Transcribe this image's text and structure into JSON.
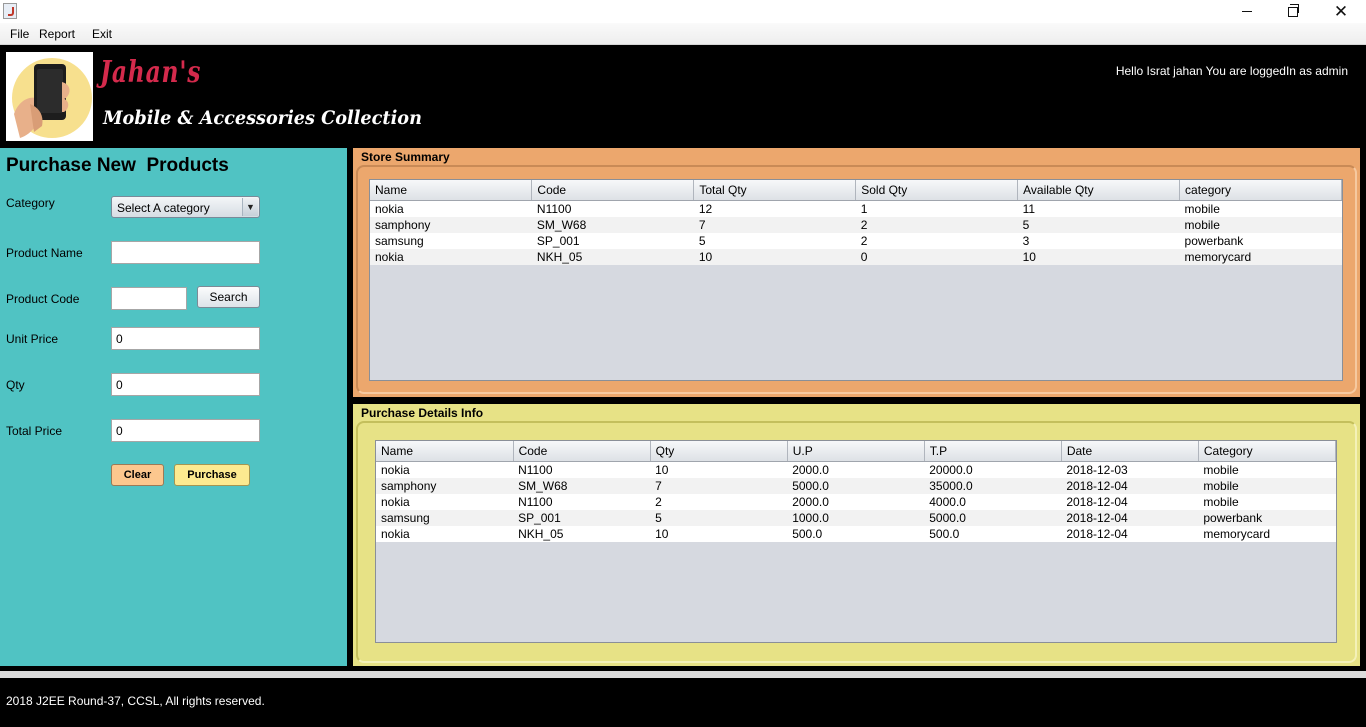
{
  "menu": {
    "items": [
      "File",
      "Report",
      "Exit"
    ]
  },
  "header": {
    "brand_title": "Jahan's",
    "brand_subtitle": "Mobile & Accessories Collection",
    "greeting": "Hello Israt jahan You are loggedIn as admin"
  },
  "form": {
    "heading": "Purchase New  Products",
    "category_label": "Category",
    "category_selected": "Select A category",
    "product_name_label": "Product Name",
    "product_name_value": "",
    "product_code_label": "Product Code",
    "product_code_value": "",
    "search_label": "Search",
    "unit_price_label": "Unit Price",
    "unit_price_value": "0",
    "qty_label": "Qty",
    "qty_value": "0",
    "total_price_label": "Total Price",
    "total_price_value": "0",
    "clear_label": "Clear",
    "purchase_label": "Purchase"
  },
  "store_summary": {
    "title": "Store Summary",
    "columns": [
      "Name",
      "Code",
      "Total Qty",
      "Sold Qty",
      "Available Qty",
      "category"
    ],
    "rows": [
      [
        "nokia",
        "N1100",
        "12",
        "1",
        "11",
        "mobile"
      ],
      [
        "samphony",
        "SM_W68",
        "7",
        "2",
        "5",
        "mobile"
      ],
      [
        "samsung",
        "SP_001",
        "5",
        "2",
        "3",
        "powerbank"
      ],
      [
        "nokia",
        "NKH_05",
        "10",
        "0",
        "10",
        "memorycard"
      ]
    ]
  },
  "purchase_details": {
    "title": "Purchase Details Info",
    "columns": [
      "Name",
      "Code",
      "Qty",
      "U.P",
      "T.P",
      "Date",
      "Category"
    ],
    "rows": [
      [
        "nokia",
        "N1100",
        "10",
        "2000.0",
        "20000.0",
        "2018-12-03",
        "mobile"
      ],
      [
        "samphony",
        "SM_W68",
        "7",
        "5000.0",
        "35000.0",
        "2018-12-04",
        "mobile"
      ],
      [
        "nokia",
        "N1100",
        "2",
        "2000.0",
        "4000.0",
        "2018-12-04",
        "mobile"
      ],
      [
        "samsung",
        "SP_001",
        "5",
        "1000.0",
        "5000.0",
        "2018-12-04",
        "powerbank"
      ],
      [
        "nokia",
        "NKH_05",
        "10",
        "500.0",
        "500.0",
        "2018-12-04",
        "memorycard"
      ]
    ]
  },
  "footer": {
    "text": "2018 J2EE Round-37, CCSL, All rights reserved."
  },
  "colors": {
    "left_panel": "#50c3c3",
    "store_panel": "#eca76d",
    "purchase_panel": "#e7e286",
    "brand_red": "#d42a4c",
    "clear_button": "#fcc78e",
    "purchase_button": "#fcea90"
  },
  "icons": {
    "window_icon": "java-app-icon",
    "minimize": "minimize-icon",
    "maximize": "maximize-icon",
    "close": "close-icon",
    "logo": "phone-in-hand-logo",
    "dropdown": "chevron-down-icon"
  }
}
